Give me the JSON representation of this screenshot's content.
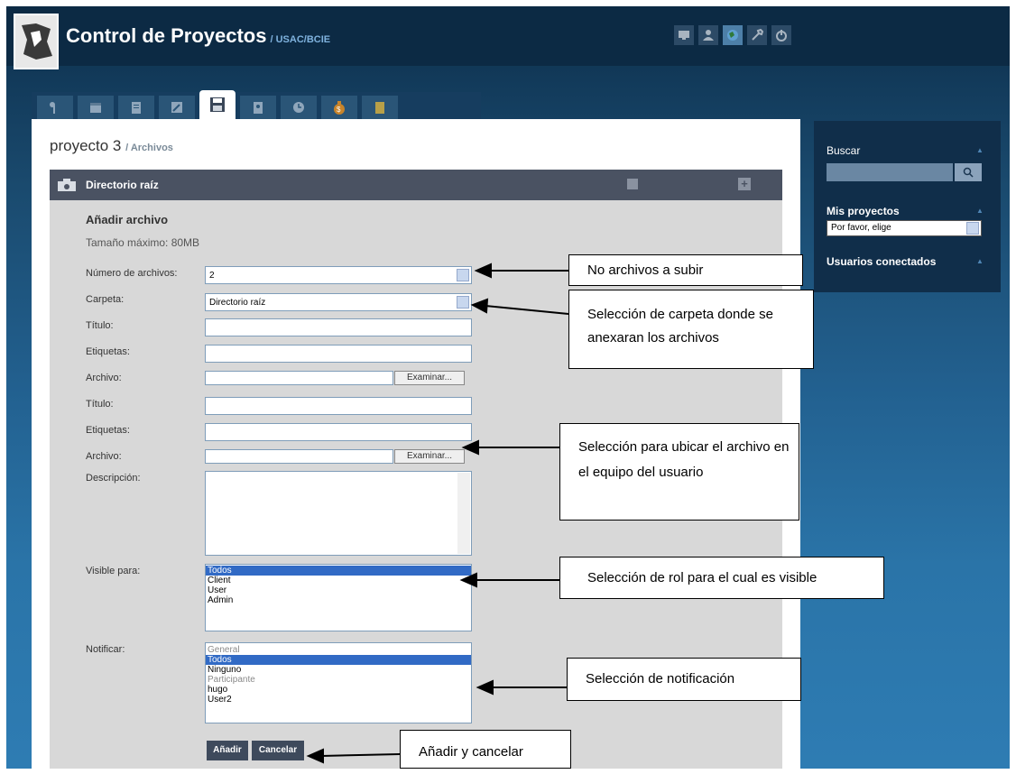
{
  "header": {
    "title": "Control de Proyectos",
    "subtitle": "/ USAC/BCIE",
    "icons": [
      "monitor-icon",
      "user-icon",
      "globe-icon",
      "wrench-icon",
      "power-icon"
    ]
  },
  "tabs": [
    "key-icon",
    "calendar-icon",
    "clipboard-icon",
    "edit-icon",
    "save-icon",
    "contact-icon",
    "clock-icon",
    "money-bag-icon",
    "notes-icon"
  ],
  "page": {
    "title": "proyecto 3",
    "subtitle": "/ Archivos"
  },
  "directory": {
    "label": "Directorio raíz"
  },
  "form": {
    "heading": "Añadir archivo",
    "max_size": "Tamaño máximo: 80MB",
    "num_files_label": "Número de archivos:",
    "num_files_value": "2",
    "folder_label": "Carpeta:",
    "folder_value": "Directorio raíz",
    "title_label": "Título:",
    "tags_label": "Etiquetas:",
    "file_label": "Archivo:",
    "browse_label": "Examinar...",
    "description_label": "Descripción:",
    "visible_label": "Visible para:",
    "visible_options": [
      "Todos",
      "Client",
      "User",
      "Admin"
    ],
    "notify_label": "Notificar:",
    "notify_options": [
      "General",
      "Todos",
      "Ninguno",
      "Participante",
      "hugo",
      "User2"
    ],
    "add_button": "Añadir",
    "cancel_button": "Cancelar"
  },
  "sidebar": {
    "search_label": "Buscar",
    "projects_label": "Mis proyectos",
    "projects_value": "Por favor, elige",
    "users_label": "Usuarios conectados"
  },
  "callouts": {
    "num_files": "No archivos a subir",
    "folder": "Selección de carpeta donde se anexaran los archivos",
    "browse": "Selección para ubicar el archivo en el equipo del usuario",
    "role": "Selección de rol para el cual es visible",
    "notify": "Selección de notificación",
    "buttons": "Añadir y cancelar"
  },
  "colors": {
    "header_bg": "#0c2a44",
    "dir_bar": "#4a5262",
    "selected": "#316ac5",
    "link": "#7fb2de"
  }
}
